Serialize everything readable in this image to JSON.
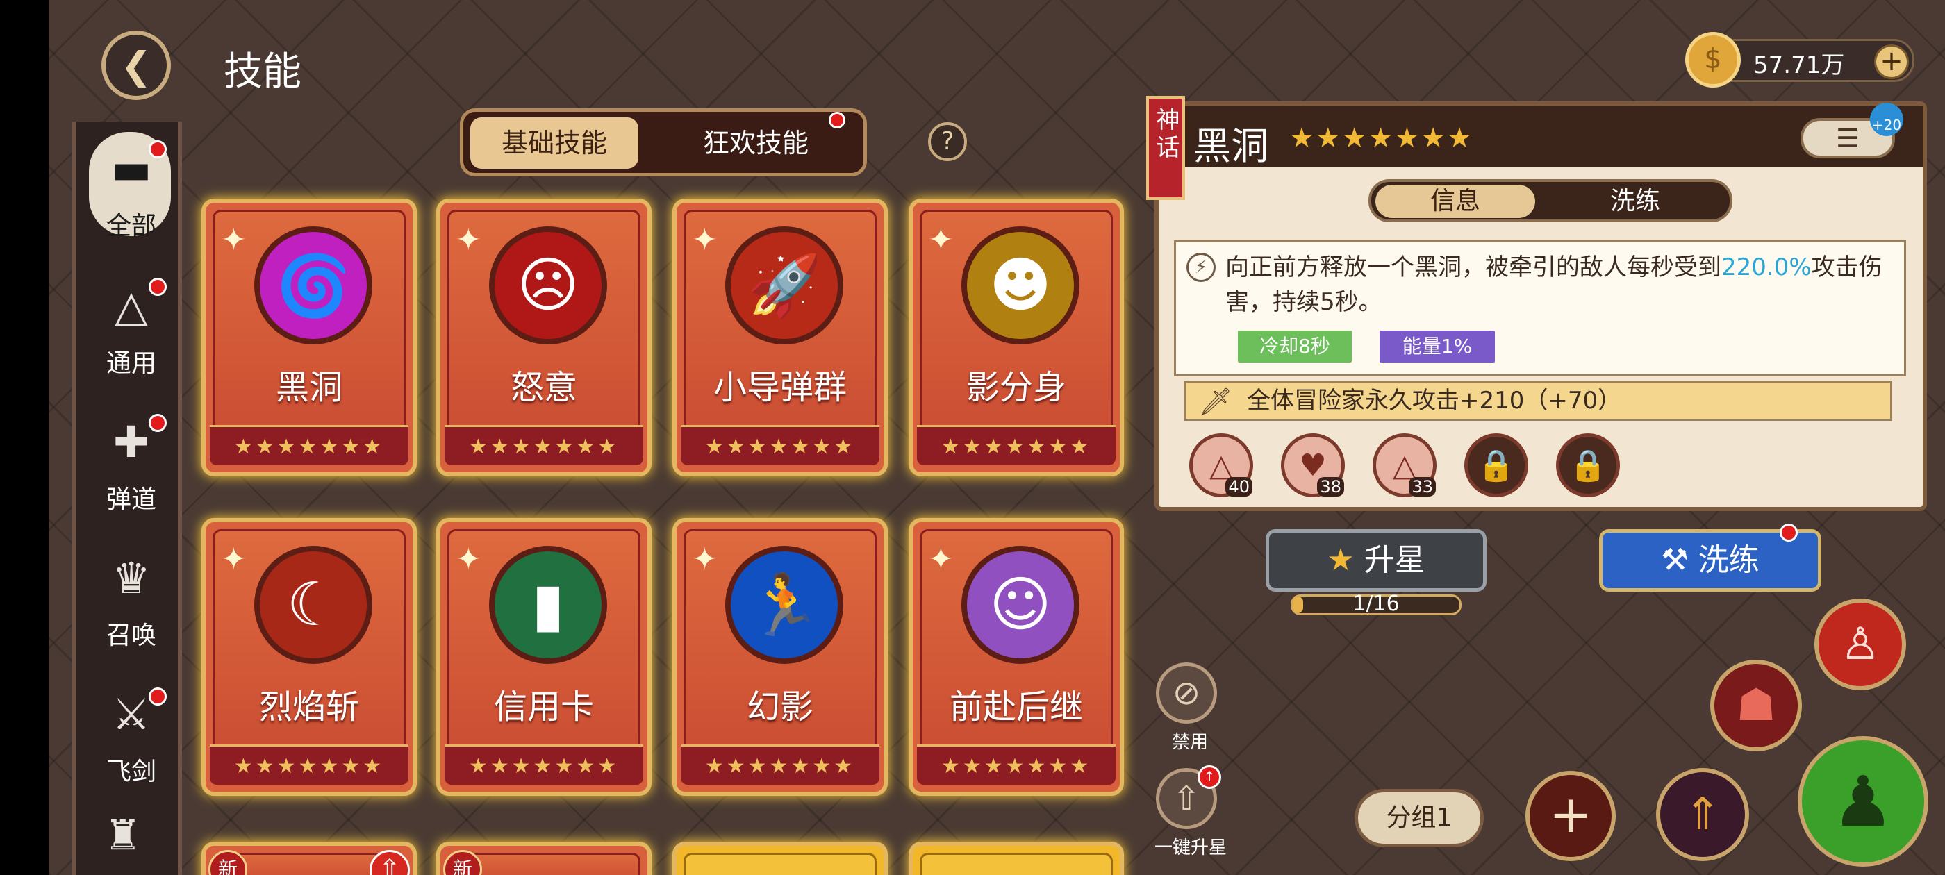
{
  "header": {
    "title": "技能",
    "back_icon": "back-arrow-icon"
  },
  "currency": {
    "value": "57.71万",
    "icon": "gold-coin-icon"
  },
  "sidebar": {
    "items": [
      {
        "label": "全部",
        "icon": "all-icon",
        "badge": true,
        "selected": true
      },
      {
        "label": "通用",
        "icon": "general-icon",
        "badge": true
      },
      {
        "label": "弹道",
        "icon": "projectile-icon",
        "badge": true
      },
      {
        "label": "召唤",
        "icon": "summon-icon",
        "badge": false
      },
      {
        "label": "飞剑",
        "icon": "flying-sword-icon",
        "badge": true
      }
    ]
  },
  "tabs": [
    {
      "label": "基础技能",
      "active": true
    },
    {
      "label": "狂欢技能",
      "active": false,
      "badge": true
    }
  ],
  "cards": [
    {
      "name": "黑洞",
      "stars": "★★★★★★★",
      "color": "#c020c0"
    },
    {
      "name": "怒意",
      "stars": "★★★★★★★",
      "color": "#b01818"
    },
    {
      "name": "小导弹群",
      "stars": "★★★★★★★",
      "color": "#b82a18"
    },
    {
      "name": "影分身",
      "stars": "★★★★★★★",
      "color": "#b08010"
    },
    {
      "name": "烈焰斩",
      "stars": "★★★★★★★",
      "color": "#a82818"
    },
    {
      "name": "信用卡",
      "stars": "★★★★★★★",
      "color": "#207040"
    },
    {
      "name": "幻影",
      "stars": "★★★★★★★",
      "color": "#1050c0"
    },
    {
      "name": "前赴后继",
      "stars": "★★★★★★★",
      "color": "#9050c0"
    }
  ],
  "partial_cards": [
    {
      "badge": "新"
    },
    {
      "badge": "新"
    }
  ],
  "detail": {
    "rarity": "神话",
    "name": "黑洞",
    "stars": "★★★★★★★",
    "list_badge": "+20",
    "subtabs": [
      "信息",
      "洗练"
    ],
    "description_1": "向正前方释放一个黑洞，被牵引的敌人每秒受到",
    "description_hl": "220.0%",
    "description_2": "攻击伤害，持续5秒。",
    "tags": [
      {
        "label": "冷却8秒",
        "color": "#6cbf5a"
      },
      {
        "label": "能量1%",
        "color": "#7a5ac8"
      }
    ],
    "bonus": "全体冒险家永久攻击+210（+70）",
    "runes": [
      {
        "icon": "triangle-rune-icon",
        "count": "40",
        "locked": false
      },
      {
        "icon": "heart-rune-icon",
        "count": "38",
        "locked": false
      },
      {
        "icon": "triangle-rune-icon",
        "count": "33",
        "locked": false
      },
      {
        "icon": "lock-icon",
        "count": "",
        "locked": true
      },
      {
        "icon": "lock-icon",
        "count": "",
        "locked": true
      }
    ]
  },
  "actions": {
    "upgrade_star": "升星",
    "wash": "洗练",
    "progress_text": "1/16",
    "progress": 0.0625,
    "ban": "禁用",
    "one_click_star": "一键升星",
    "group": "分组1"
  }
}
